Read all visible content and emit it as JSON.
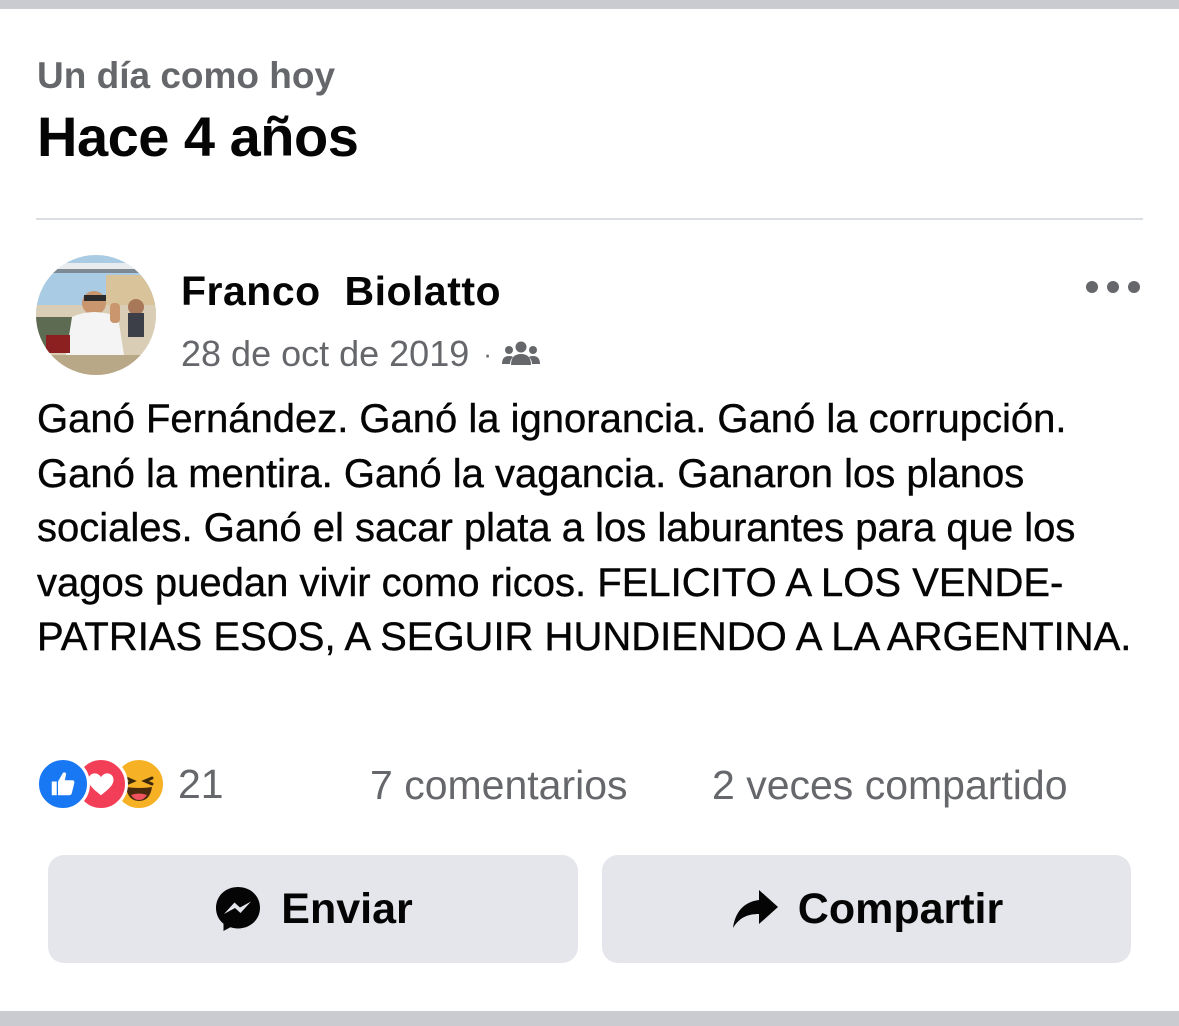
{
  "memory": {
    "label": "Un día como hoy",
    "title": "Hace 4 años"
  },
  "post": {
    "author": "Franco  Biolatto",
    "date": "28 de oct de 2019",
    "separator": "·",
    "audience_icon": "friends-icon",
    "text": "Ganó Fernández. Ganó la ignorancia. Ganó la corrupción. Ganó la mentira. Ganó la vagancia. Ganaron los planos sociales. Ganó el sacar plata a los laburantes para que los vagos puedan vivir como ricos. FELICITO A LOS VENDE-PATRIAS ESOS, A SEGUIR HUNDIENDO A LA ARGENTINA."
  },
  "stats": {
    "reaction_icons": [
      "like-icon",
      "love-icon",
      "haha-icon"
    ],
    "reaction_count": "21",
    "comments": "7 comentarios",
    "shares": "2 veces compartido"
  },
  "actions": {
    "send_label": "Enviar",
    "send_icon": "messenger-icon",
    "share_label": "Compartir",
    "share_icon": "share-arrow-icon"
  },
  "colors": {
    "secondary_text": "#65676b",
    "primary_text": "#050505",
    "button_bg": "#e4e6eb",
    "like_blue": "#1877f2",
    "love_red": "#f33e58",
    "haha_yellow": "#f7b125"
  }
}
